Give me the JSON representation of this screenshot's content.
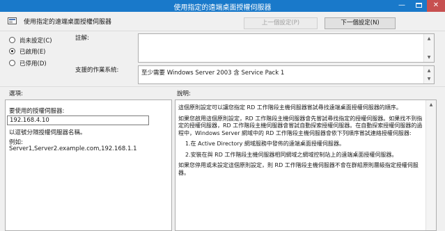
{
  "window": {
    "title": "使用指定的遠端桌面授權伺服器",
    "minimize_symbol": "—",
    "close_symbol": "✕"
  },
  "header": {
    "policy_title": "使用指定的遠端桌面授權伺服器",
    "prev_button": "上一個設定(P)",
    "next_button": "下一個設定(N)"
  },
  "state": {
    "options": [
      {
        "label": "尚未設定(C)",
        "selected": false
      },
      {
        "label": "已啟用(E)",
        "selected": true
      },
      {
        "label": "已停用(D)",
        "selected": false
      }
    ]
  },
  "comment": {
    "label": "註解:",
    "value": ""
  },
  "supported": {
    "label": "支援的作業系統:",
    "value": "至少需要 Windows Server 2003 含 Service Pack 1"
  },
  "options_panel": {
    "heading": "選項:",
    "field_label": "要使用的授權伺服器:",
    "field_value": "192.168.4.10",
    "hint": "以逗號分隔授權伺服器名稱。",
    "example_label": "例如:",
    "example_value": "Server1,Server2.example.com,192.168.1.1"
  },
  "help_panel": {
    "heading": "說明:",
    "paragraphs": [
      "這個原則設定可以讓您指定 RD 工作階段主機伺服器嘗試尋找遠端桌面授權伺服器的順序。",
      "如果您啟用這個原則設定，RD 工作階段主機伺服器會先嘗試尋找指定的授權伺服器。如果找不到指定的授權伺服器，RD 工作階段主機伺服器會嘗試自動探索授權伺服器。在自動探索授權伺服器的過程中，Windows Server 網域中的 RD 工作階段主機伺服器會依下列順序嘗試連絡授權伺服器:",
      "1.在 Active Directory 網域服務中發佈的遠端桌面授權伺服器。",
      "2.安裝在與 RD 工作階段主機伺服器相同網域之網域控制站上的遠端桌面授權伺服器。",
      "如果您停用或未設定這個原則設定，則 RD 工作階段主機伺服器不會在群組原則層級指定授權伺服器。"
    ]
  },
  "icons": {
    "scroll_up": "▲",
    "scroll_down": "▼"
  }
}
